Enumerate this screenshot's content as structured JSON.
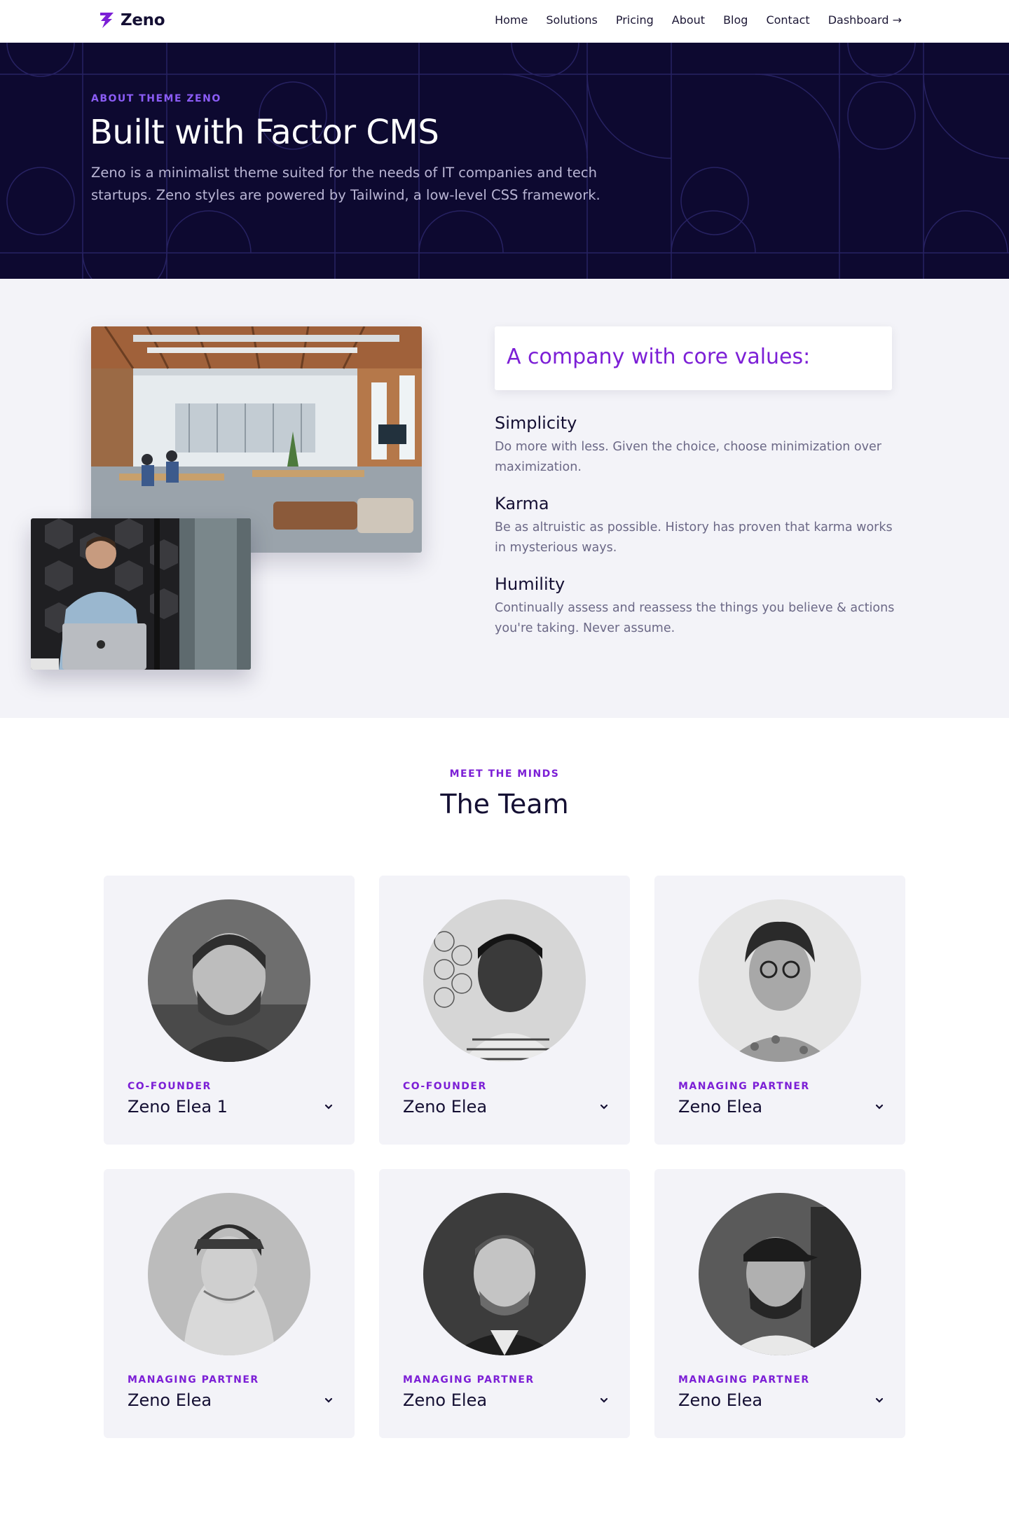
{
  "brand": {
    "name": "Zeno",
    "accent": "#7c1fd6",
    "dark": "#0d0930"
  },
  "nav": {
    "items": [
      "Home",
      "Solutions",
      "Pricing",
      "About",
      "Blog",
      "Contact"
    ],
    "dashboard": "Dashboard →"
  },
  "hero": {
    "kicker": "ABOUT THEME ZENO",
    "title": "Built with Factor CMS",
    "description": "Zeno is a minimalist theme suited for the needs of IT companies and tech startups. Zeno styles are powered by Tailwind, a low-level CSS framework."
  },
  "values": {
    "heading": "A company with core values:",
    "items": [
      {
        "name": "Simplicity",
        "desc": "Do more with less. Given the choice, choose minimization over maximization."
      },
      {
        "name": "Karma",
        "desc": "Be as altruistic as possible. History has proven that karma works in mysterious ways."
      },
      {
        "name": "Humility",
        "desc": "Continually assess and reassess the things you believe & actions you're taking. Never assume."
      }
    ]
  },
  "team": {
    "kicker": "MEET THE MINDS",
    "title": "The Team",
    "members": [
      {
        "role": "CO-FOUNDER",
        "name": "Zeno Elea 1"
      },
      {
        "role": "CO-FOUNDER",
        "name": "Zeno Elea"
      },
      {
        "role": "MANAGING PARTNER",
        "name": "Zeno Elea"
      },
      {
        "role": "MANAGING PARTNER",
        "name": "Zeno Elea"
      },
      {
        "role": "MANAGING PARTNER",
        "name": "Zeno Elea"
      },
      {
        "role": "MANAGING PARTNER",
        "name": "Zeno Elea"
      }
    ]
  },
  "icons": {
    "logo": "zeno-bolt-icon",
    "chevron": "chevron-down-icon"
  }
}
